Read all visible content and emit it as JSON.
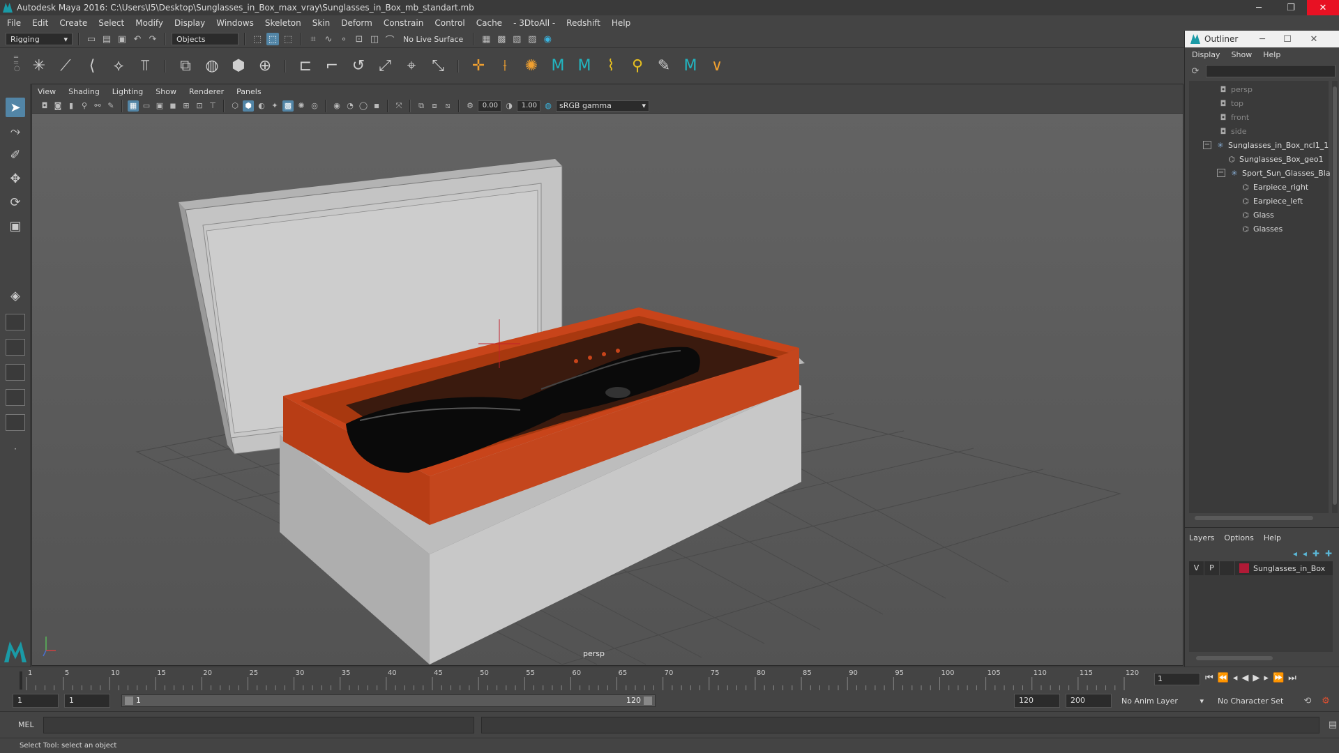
{
  "window": {
    "title": "Autodesk Maya 2016: C:\\Users\\I5\\Desktop\\Sunglasses_in_Box_max_vray\\Sunglasses_in_Box_mb_standart.mb",
    "minimize": "─",
    "maximize": "❐",
    "close": "✕"
  },
  "menubar": [
    "File",
    "Edit",
    "Create",
    "Select",
    "Modify",
    "Display",
    "Windows",
    "Skeleton",
    "Skin",
    "Deform",
    "Constrain",
    "Control",
    "Cache",
    "- 3DtoAll -",
    "Redshift",
    "Help"
  ],
  "statusline": {
    "mode_dropdown": "Rigging",
    "selection_dropdown": "Objects",
    "live_surface": "No Live Surface"
  },
  "viewport": {
    "menu": [
      "View",
      "Shading",
      "Lighting",
      "Show",
      "Renderer",
      "Panels"
    ],
    "exposure": "0.00",
    "gamma": "1.00",
    "colorspace": "sRGB gamma",
    "camera_label": "persp"
  },
  "outliner": {
    "title": "Outliner",
    "menu": [
      "Display",
      "Show",
      "Help"
    ],
    "items": [
      {
        "label": "persp",
        "dim": true
      },
      {
        "label": "top",
        "dim": true
      },
      {
        "label": "front",
        "dim": true
      },
      {
        "label": "side",
        "dim": true
      },
      {
        "label": "Sunglasses_in_Box_ncl1_1",
        "dim": false
      },
      {
        "label": "Sunglasses_Box_geo1",
        "dim": false
      },
      {
        "label": "Sport_Sun_Glasses_Bla",
        "dim": false
      },
      {
        "label": "Earpiece_right",
        "dim": false
      },
      {
        "label": "Earpiece_left",
        "dim": false
      },
      {
        "label": "Glass",
        "dim": false
      },
      {
        "label": "Glasses",
        "dim": false
      }
    ]
  },
  "layers": {
    "menu": [
      "Layers",
      "Options",
      "Help"
    ],
    "row": {
      "v": "V",
      "p": "P",
      "name": "Sunglasses_in_Box",
      "color": "#b01a36"
    }
  },
  "timeline": {
    "ticks": [
      "1",
      "5",
      "10",
      "15",
      "20",
      "25",
      "30",
      "35",
      "40",
      "45",
      "50",
      "55",
      "60",
      "65",
      "70",
      "75",
      "80",
      "85",
      "90",
      "95",
      "100",
      "105",
      "110",
      "115",
      "120"
    ],
    "current_frame": "1"
  },
  "range": {
    "start": "1",
    "playback_start": "1",
    "bar_start": "1",
    "bar_end": "120",
    "playback_end": "120",
    "end": "200",
    "anim_layer": "No Anim Layer",
    "character_set": "No Character Set"
  },
  "command": {
    "language": "MEL"
  },
  "help_line": "Select Tool: select an object",
  "colors": {
    "box_interior": "#c8441a",
    "box_exterior": "#c6c6c6",
    "accent": "#5285a6"
  }
}
